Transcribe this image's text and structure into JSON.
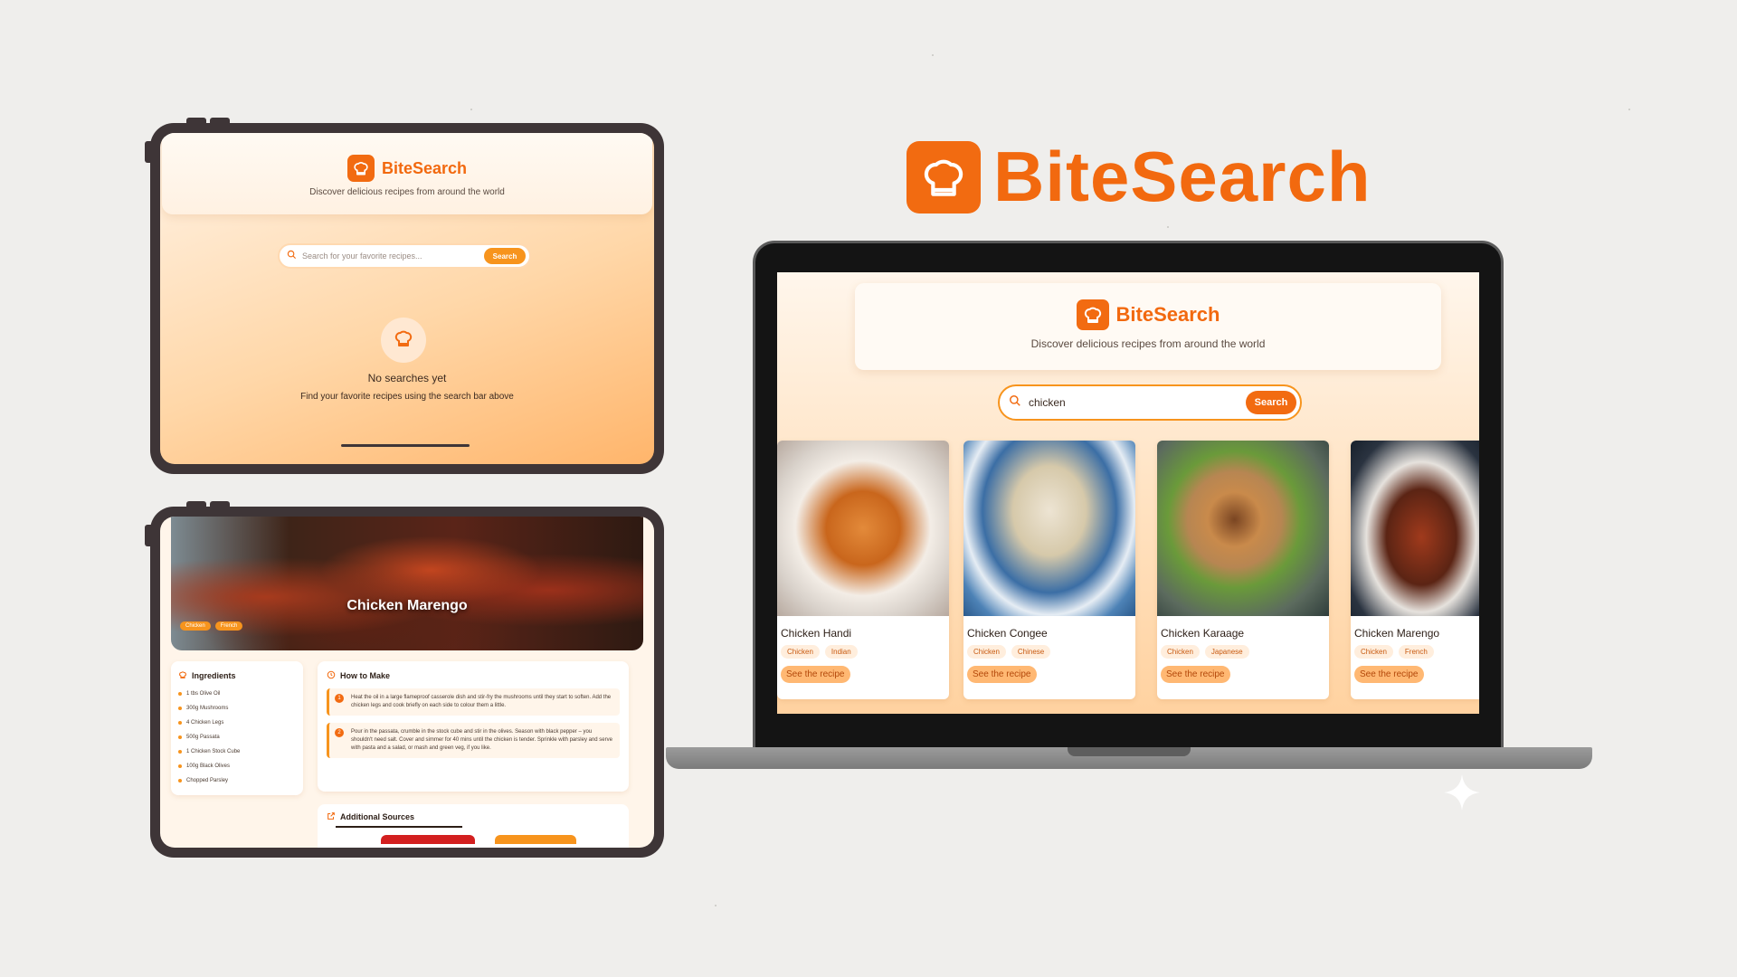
{
  "brand": {
    "name": "BiteSearch",
    "tagline": "Discover delicious recipes from around the world"
  },
  "tablet_home": {
    "search_placeholder": "Search for your favorite recipes...",
    "search_button": "Search",
    "empty_title": "No searches yet",
    "empty_subtitle": "Find your favorite recipes using the search bar above"
  },
  "tablet_detail": {
    "title": "Chicken Marengo",
    "tags": [
      "Chicken",
      "French"
    ],
    "ingredients_heading": "Ingredients",
    "ingredients": [
      "1 tbs Olive Oil",
      "300g Mushrooms",
      "4 Chicken Legs",
      "500g Passata",
      "1 Chicken Stock Cube",
      "100g Black Olives",
      "Chopped Parsley"
    ],
    "how_heading": "How to Make",
    "steps": [
      {
        "num": "1",
        "text": "Heat the oil in a large flameproof casserole dish and stir-fry the mushrooms until they start to soften. Add the chicken legs and cook briefly on each side to colour them a little."
      },
      {
        "num": "2",
        "text": "Pour in the passata, crumble in the stock cube and stir in the olives. Season with black pepper – you shouldn't need salt. Cover and simmer for 40 mins until the chicken is tender. Sprinkle with parsley and serve with pasta and a salad, or mash and green veg, if you like."
      }
    ],
    "sources_heading": "Additional Sources"
  },
  "laptop": {
    "search_value": "chicken",
    "search_button": "Search",
    "recipes": [
      {
        "name": "Chicken Handi",
        "tags": [
          "Chicken",
          "Indian"
        ],
        "button": "See the recipe"
      },
      {
        "name": "Chicken Congee",
        "tags": [
          "Chicken",
          "Chinese"
        ],
        "button": "See the recipe"
      },
      {
        "name": "Chicken Karaage",
        "tags": [
          "Chicken",
          "Japanese"
        ],
        "button": "See the recipe"
      },
      {
        "name": "Chicken Marengo",
        "tags": [
          "Chicken",
          "French"
        ],
        "button": "See the recipe"
      }
    ]
  },
  "colors": {
    "accent": "#f2690f",
    "button": "#f7941d",
    "background": "#efeeec",
    "device_frame": "#3e3537"
  },
  "icons": [
    "chef-hat-icon",
    "search-icon",
    "clock-icon",
    "external-link-icon",
    "sparkle-icon"
  ]
}
